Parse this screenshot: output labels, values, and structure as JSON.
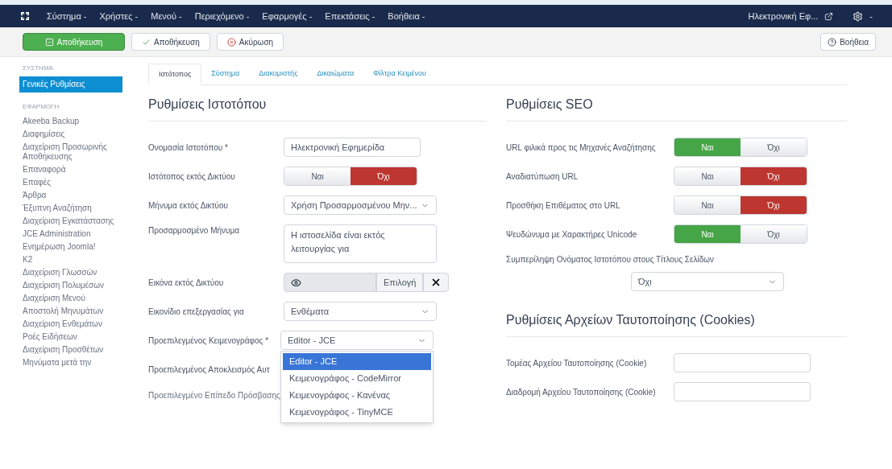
{
  "top_menu": {
    "items": [
      "Σύστημα -",
      "Χρήστες -",
      "Μενού -",
      "Περιεχόμενο -",
      "Εφαρμογές -",
      "Επεκτάσεις -",
      "Βοήθεια -"
    ],
    "site_link": "Ηλεκτρονική Εφ...",
    "settings_caret": "-"
  },
  "toolbar": {
    "buttons": [
      {
        "label": "Αποθήκευση",
        "kind": "primary"
      },
      {
        "label": "Αποθήκευση",
        "kind": "check"
      },
      {
        "label": "Ακύρωση",
        "kind": "cancel"
      }
    ],
    "help": "Βοήθεια"
  },
  "sidebar": {
    "sections": [
      {
        "heading": "ΣΥΣΤΗΜΑ",
        "items": [
          {
            "label": "Γενικές Ρυθμίσεις",
            "selected": true
          }
        ]
      },
      {
        "heading": "ΕΦΑΡΜΟΓΗ",
        "items": [
          {
            "label": "Akeeba Backup",
            "selected": false
          },
          {
            "label": "Διαφημίσεις",
            "selected": false
          },
          {
            "label": "Διαχείριση Προσωρινής Αποθήκευσης",
            "selected": false
          },
          {
            "label": "Επαναφορά",
            "selected": false
          },
          {
            "label": "Επαφές",
            "selected": false
          },
          {
            "label": "Άρθρα",
            "selected": false
          },
          {
            "label": "Έξυπνη Αναζήτηση",
            "selected": false
          },
          {
            "label": "Διαχείριση Εγκατάστασης",
            "selected": false
          },
          {
            "label": "JCE Administration",
            "selected": false
          },
          {
            "label": "Ενημέρωση Joomla!",
            "selected": false
          },
          {
            "label": "K2",
            "selected": false
          },
          {
            "label": "Διαχείριση Γλωσσών",
            "selected": false
          },
          {
            "label": "Διαχείριση Πολυμέσων",
            "selected": false
          },
          {
            "label": "Διαχείριση Μενού",
            "selected": false
          },
          {
            "label": "Αποστολή Μηνυμάτων",
            "selected": false
          },
          {
            "label": "Διαχείριση Ενθεμάτων",
            "selected": false
          },
          {
            "label": "Ροές Ειδήσεων",
            "selected": false
          },
          {
            "label": "Διαχείριση Προσθέτων",
            "selected": false
          },
          {
            "label": "Μηνύματα μετά την",
            "selected": false
          }
        ]
      }
    ]
  },
  "tabs": [
    {
      "label": "Ιστότοπος",
      "selected": true
    },
    {
      "label": "Σύστημα",
      "selected": false
    },
    {
      "label": "Διακομιστής",
      "selected": false
    },
    {
      "label": "Δικαιώματα",
      "selected": false
    },
    {
      "label": "Φίλτρα Κειμένου",
      "selected": false
    }
  ],
  "site_settings": {
    "title": "Ρυθμίσεις Ιστοτόπου",
    "fields": [
      {
        "kind": "text",
        "label": "Ονομασία Ιστοτόπου *",
        "value": "Ηλεκτρονική Εφημερίδα"
      },
      {
        "kind": "toggle",
        "label": "Ιστότοπος εκτός Δικτύου",
        "options": [
          {
            "label": "Ναι",
            "selected": false
          },
          {
            "label": "Όχι",
            "selected": true
          }
        ]
      },
      {
        "kind": "select",
        "label": "Μήνυμα εκτός Δικτύου",
        "value": "Χρήση Προσαρμοσμένου Μην..."
      },
      {
        "kind": "textarea",
        "label": "Προσαρμοσμένο Μήνυμα",
        "value": "Η ιστοσελίδα είναι εκτός λειτουργίας για"
      },
      {
        "kind": "media",
        "label": "Εικόνα εκτός Δικτύου",
        "button": "Επιλογή"
      },
      {
        "kind": "select",
        "label": "Εικονίδιο επεξεργασίας για",
        "value": "Ενθέματα"
      },
      {
        "kind": "dropdown",
        "label": "Προεπιλεγμένος Κειμενογράφος *",
        "value": "Editor - JCE",
        "options": [
          {
            "label": "Editor - JCE",
            "selected": true
          },
          {
            "label": "Κειμενογράφος - CodeMirror",
            "selected": false
          },
          {
            "label": "Κειμενογράφος - Κανένας",
            "selected": false
          },
          {
            "label": "Κειμενογράφος - TinyMCE",
            "selected": false
          }
        ]
      },
      {
        "kind": "covered",
        "label": "Προεπιλεγμένος Αποκλεισμός Αυτ"
      },
      {
        "kind": "faded",
        "label": "Προεπιλεγμένο Επίπεδο Πρόσβασης"
      }
    ]
  },
  "seo_settings": {
    "title": "Ρυθμίσεις SEO",
    "fields": [
      {
        "kind": "toggle",
        "label": "URL φιλικά προς τις Μηχανές Αναζήτησης",
        "options": [
          {
            "label": "Ναι",
            "selected": true
          },
          {
            "label": "Όχι",
            "selected": false
          }
        ]
      },
      {
        "kind": "toggle",
        "label": "Αναδιατύπωση URL",
        "options": [
          {
            "label": "Ναι",
            "selected": false
          },
          {
            "label": "Όχι",
            "selected": true
          }
        ]
      },
      {
        "kind": "toggle",
        "label": "Προσθήκη Επιθέματος στο URL",
        "options": [
          {
            "label": "Ναι",
            "selected": false
          },
          {
            "label": "Όχι",
            "selected": true
          }
        ]
      },
      {
        "kind": "toggle",
        "label": "Ψευδώνυμα με Χαρακτήρες Unicode",
        "options": [
          {
            "label": "Ναι",
            "selected": true
          },
          {
            "label": "Όχι",
            "selected": false
          }
        ]
      },
      {
        "kind": "stacked-select",
        "label": "Συμπερίληψη Ονόματος Ιστοτόπου στους Τίτλους Σελίδων",
        "value": "Όχι"
      }
    ]
  },
  "cookie_settings": {
    "title": "Ρυθμίσεις Αρχείων Ταυτοποίησης (Cookies)",
    "fields": [
      {
        "kind": "text",
        "label": "Τομέας Αρχείου Ταυτοποίησης (Cookie)"
      },
      {
        "kind": "text",
        "label": "Διαδρομή Αρχείου Ταυτοποίησης (Cookie)"
      }
    ]
  }
}
